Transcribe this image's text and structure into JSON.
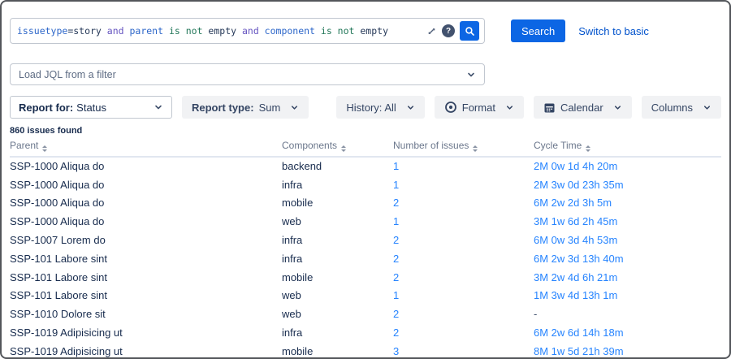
{
  "colors": {
    "accent_blue": "#0c66e4",
    "link_blue": "#2684ff",
    "window_border": "#53565b",
    "button_gray": "#f1f2f4",
    "dark_navy": "#172b4d"
  },
  "jql": {
    "query": "issuetype=story and parent is not empty and component is not empty",
    "token_colors": {
      "field": "#2c66c9",
      "keyword": "#6554c0",
      "operator": "#227759",
      "text": "#253858"
    },
    "tokens": [
      {
        "text": "issuetype",
        "type": "field"
      },
      {
        "text": "=story",
        "type": "text"
      },
      {
        "text": " and ",
        "type": "keyword"
      },
      {
        "text": "parent",
        "type": "field"
      },
      {
        "text": " is not",
        "type": "operator"
      },
      {
        "text": " empty",
        "type": "text"
      },
      {
        "text": " and ",
        "type": "keyword"
      },
      {
        "text": "component",
        "type": "field"
      },
      {
        "text": " is not",
        "type": "operator"
      },
      {
        "text": " empty",
        "type": "text"
      }
    ],
    "help_icon_glyph": "?"
  },
  "search": {
    "button_label": "Search",
    "switch_link_label": "Switch to basic"
  },
  "filter": {
    "placeholder": "Load JQL from a filter"
  },
  "toolbar": {
    "report_for_label": "Report for:",
    "report_for_value": "Status",
    "report_type_label": "Report type:",
    "report_type_value": "Sum",
    "history_label": "History: All",
    "format_label": "Format",
    "calendar_label": "Calendar",
    "columns_label": "Columns"
  },
  "results": {
    "count_text": "860 issues found"
  },
  "table": {
    "headers": [
      "Parent",
      "Components",
      "Number of issues",
      "Cycle Time"
    ],
    "rows": [
      {
        "parent": "SSP-1000 Aliqua do",
        "component": "backend",
        "issues": "1",
        "cycle_time": "2M 0w 1d 4h 20m"
      },
      {
        "parent": "SSP-1000 Aliqua do",
        "component": "infra",
        "issues": "1",
        "cycle_time": "2M 3w 0d 23h 35m"
      },
      {
        "parent": "SSP-1000 Aliqua do",
        "component": "mobile",
        "issues": "2",
        "cycle_time": "6M 2w 2d 3h 5m"
      },
      {
        "parent": "SSP-1000 Aliqua do",
        "component": "web",
        "issues": "1",
        "cycle_time": "3M 1w 6d 2h 45m"
      },
      {
        "parent": "SSP-1007 Lorem do",
        "component": "infra",
        "issues": "2",
        "cycle_time": "6M 0w 3d 4h 53m"
      },
      {
        "parent": "SSP-101 Labore sint",
        "component": "infra",
        "issues": "2",
        "cycle_time": "6M 2w 3d 13h 40m"
      },
      {
        "parent": "SSP-101 Labore sint",
        "component": "mobile",
        "issues": "2",
        "cycle_time": "3M 2w 4d 6h 21m"
      },
      {
        "parent": "SSP-101 Labore sint",
        "component": "web",
        "issues": "1",
        "cycle_time": "1M 3w 4d 13h 1m"
      },
      {
        "parent": "SSP-1010 Dolore sit",
        "component": "web",
        "issues": "2",
        "cycle_time": "-"
      },
      {
        "parent": "SSP-1019 Adipisicing ut",
        "component": "infra",
        "issues": "2",
        "cycle_time": "6M 2w 6d 14h 18m"
      },
      {
        "parent": "SSP-1019 Adipisicing ut",
        "component": "mobile",
        "issues": "3",
        "cycle_time": "8M 1w 5d 21h 39m"
      }
    ]
  }
}
